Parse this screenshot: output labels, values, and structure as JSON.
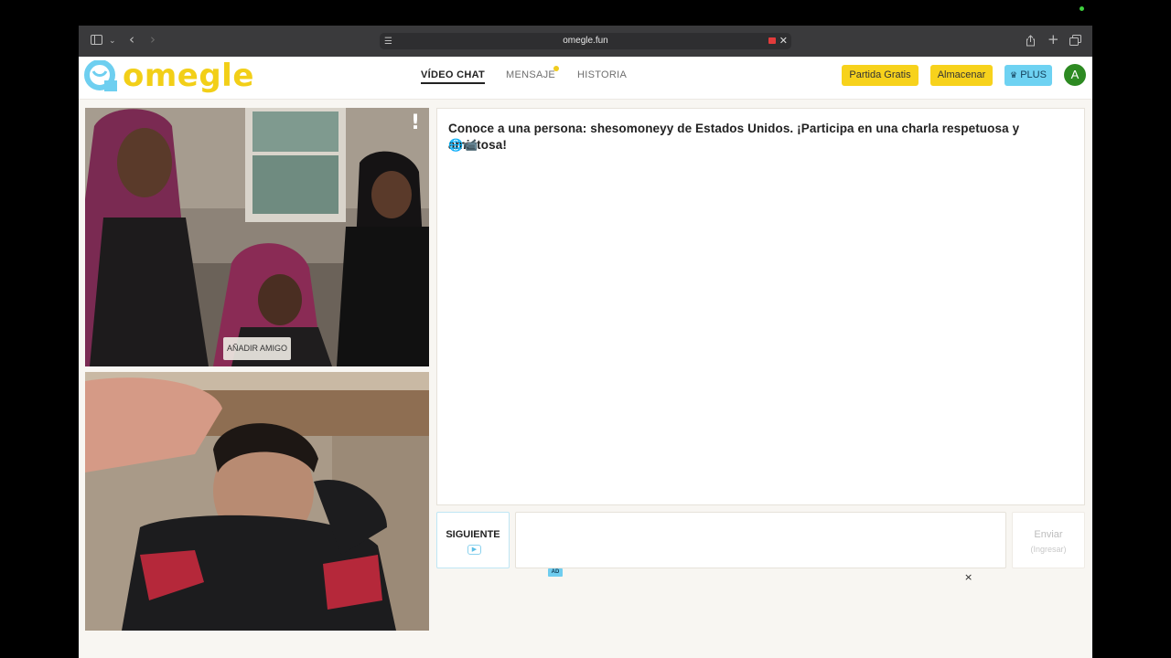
{
  "browser": {
    "url": "omegle.fun",
    "icons": {
      "sidebar": "sidebar-icon",
      "chevron": "chevron-down-icon",
      "back": "back-icon",
      "forward": "forward-icon",
      "recording": "camera-recording-icon",
      "close": "close-icon",
      "share": "share-icon",
      "new_tab": "plus-icon",
      "tabs": "tab-overview-icon"
    }
  },
  "header": {
    "logo_text": "omegle",
    "nav": [
      {
        "label": "VÍDEO CHAT",
        "active": true
      },
      {
        "label": "MENSAJE",
        "active": false,
        "notification": true
      },
      {
        "label": "HISTORIA",
        "active": false
      }
    ],
    "buttons": {
      "free_game": "Partida Gratis",
      "store": "Almacenar",
      "plus": "PLUS"
    },
    "avatar_initial": "A",
    "colors": {
      "brand_yellow": "#f7d21c",
      "plus_blue": "#6ed2f2",
      "avatar_green": "#2d8a22"
    }
  },
  "video": {
    "report_label": "!",
    "add_friend_label": "AÑADIR AMIGO"
  },
  "chat": {
    "intro_message": "Conoce a una persona: shesomoneyy de Estados Unidos. ¡Participa en una charla respetuosa y amistosa!",
    "emojis": "🌐📹"
  },
  "controls": {
    "next_label": "SIGUIENTE",
    "send_label": "Enviar",
    "send_hint": "(Ingresar)",
    "message_value": ""
  },
  "ad": {
    "badge": "AD",
    "close": "×"
  }
}
